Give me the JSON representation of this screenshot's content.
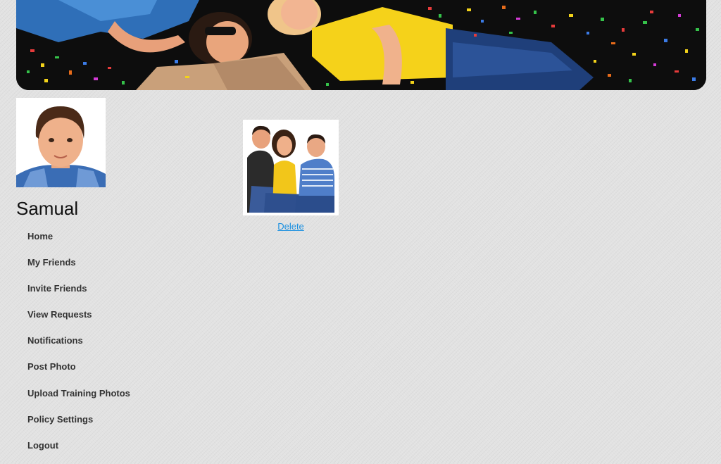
{
  "profile": {
    "name": "Samual"
  },
  "sidebar": {
    "items": [
      {
        "label": "Home"
      },
      {
        "label": "My Friends"
      },
      {
        "label": "Invite Friends"
      },
      {
        "label": "View Requests"
      },
      {
        "label": "Notifications"
      },
      {
        "label": "Post Photo"
      },
      {
        "label": "Upload Training Photos"
      },
      {
        "label": "Policy Settings"
      },
      {
        "label": "Logout"
      }
    ]
  },
  "photos": [
    {
      "delete_label": "Delete"
    }
  ],
  "colors": {
    "page_background": "#e2e2e2",
    "link": "#1a8fe0",
    "nav_text": "#333333"
  }
}
